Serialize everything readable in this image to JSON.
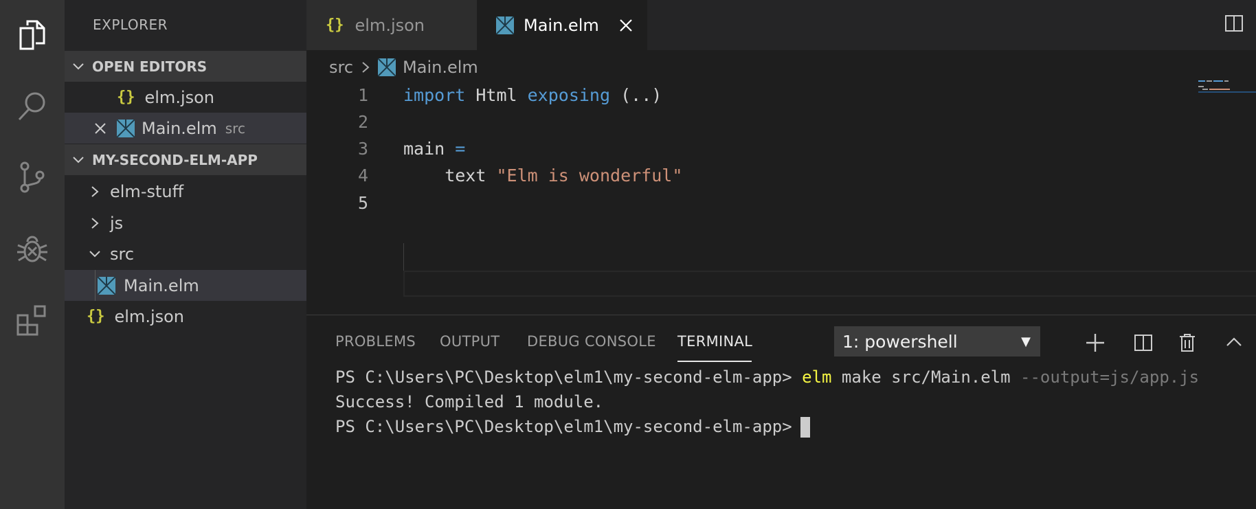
{
  "sidebar": {
    "title": "EXPLORER",
    "open_editors_label": "OPEN EDITORS",
    "open_editors": [
      {
        "name": "elm.json",
        "icon": "braces-icon"
      },
      {
        "name": "Main.elm",
        "hint": "src",
        "icon": "elm-icon"
      }
    ],
    "project_label": "MY-SECOND-ELM-APP",
    "tree": [
      {
        "name": "elm-stuff",
        "type": "folder",
        "expanded": false
      },
      {
        "name": "js",
        "type": "folder",
        "expanded": false
      },
      {
        "name": "src",
        "type": "folder",
        "expanded": true
      },
      {
        "name": "Main.elm",
        "type": "file",
        "icon": "elm-icon",
        "selected": true
      },
      {
        "name": "elm.json",
        "type": "file",
        "icon": "braces-icon"
      }
    ]
  },
  "tabs": [
    {
      "label": "elm.json",
      "icon": "braces-icon",
      "active": false
    },
    {
      "label": "Main.elm",
      "icon": "elm-icon",
      "active": true
    }
  ],
  "breadcrumb": {
    "folder": "src",
    "file": "Main.elm"
  },
  "editor": {
    "line_numbers": [
      "1",
      "2",
      "3",
      "4",
      "5"
    ],
    "current_line": 5,
    "l1": {
      "kw1": "import",
      "mod": " Html ",
      "kw2": "exposing",
      "rest": " (..)"
    },
    "l3": {
      "name": "main ",
      "op": "="
    },
    "l4": {
      "fn": "    text ",
      "str": "\"Elm is wonderful\""
    }
  },
  "panel": {
    "tabs": [
      "PROBLEMS",
      "OUTPUT",
      "DEBUG CONSOLE",
      "TERMINAL"
    ],
    "active_tab": "TERMINAL",
    "terminal_select": "1: powershell",
    "terminal": {
      "prompt": "PS C:\\Users\\PC\\Desktop\\elm1\\my-second-elm-app>",
      "cmd": "elm",
      "args": " make src/Main.elm ",
      "flag": "--output=js/app.js",
      "line2": "Success! Compiled 1 module.",
      "prompt2": "PS C:\\Users\\PC\\Desktop\\elm1\\my-second-elm-app>"
    }
  },
  "colors": {
    "keyword": "#569cd6",
    "string": "#ce9178",
    "braces": "#cbcb41",
    "elm_icon": "#519aba",
    "terminal_cmd": "#f5f543"
  }
}
